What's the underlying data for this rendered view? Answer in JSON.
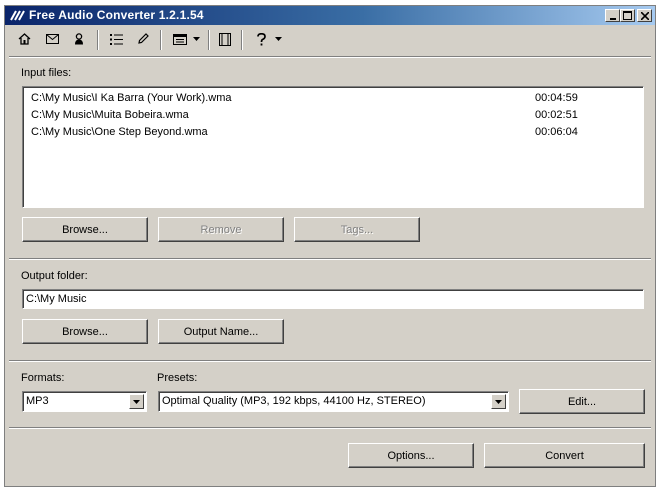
{
  "window": {
    "title": "Free Audio Converter 1.2.1.54",
    "buttons": [
      "minimize",
      "maximize",
      "close"
    ]
  },
  "toolbar": {
    "icons": [
      "home-icon",
      "mail-icon",
      "user-icon",
      "list-icon",
      "pencil-icon",
      "window-icon",
      "film-icon",
      "help-icon"
    ]
  },
  "input": {
    "label": "Input files:",
    "files": [
      {
        "path": "C:\\My Music\\I Ka Barra (Your Work).wma",
        "duration": "00:04:59"
      },
      {
        "path": "C:\\My Music\\Muita Bobeira.wma",
        "duration": "00:02:51"
      },
      {
        "path": "C:\\My Music\\One Step Beyond.wma",
        "duration": "00:06:04"
      }
    ],
    "browse_label": "Browse...",
    "remove_label": "Remove",
    "tags_label": "Tags..."
  },
  "output": {
    "label": "Output folder:",
    "folder": "C:\\My Music",
    "browse_label": "Browse...",
    "output_name_label": "Output Name..."
  },
  "format": {
    "formats_label": "Formats:",
    "format_value": "MP3",
    "presets_label": "Presets:",
    "preset_value": "Optimal Quality (MP3, 192 kbps, 44100 Hz, STEREO)",
    "edit_label": "Edit..."
  },
  "actions": {
    "options_label": "Options...",
    "convert_label": "Convert"
  },
  "colors": {
    "window_bg": "#d4d0c8",
    "title_gradient_start": "#0a246a",
    "title_gradient_end": "#a6caf0",
    "disabled_text": "#808080"
  }
}
